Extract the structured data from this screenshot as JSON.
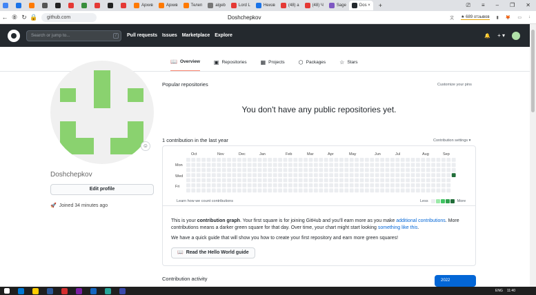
{
  "browser": {
    "tabs": [
      {
        "label": "",
        "color": "#4285f4"
      },
      {
        "label": "",
        "color": "#1a73e8"
      },
      {
        "label": "",
        "color": "#ff7a00"
      },
      {
        "label": "",
        "color": "#555555"
      },
      {
        "label": "",
        "color": "#222222"
      },
      {
        "label": "",
        "color": "#e53935"
      },
      {
        "label": "",
        "color": "#388e3c"
      },
      {
        "label": "",
        "color": "#e53935"
      },
      {
        "label": "",
        "color": "#222222"
      },
      {
        "label": "",
        "color": "#e53935"
      },
      {
        "label": "Архив",
        "color": "#ff7a00"
      },
      {
        "label": "Архив",
        "color": "#ff7a00"
      },
      {
        "label": "Телеп",
        "color": "#ff7a00"
      },
      {
        "label": "algeb",
        "color": "#777777"
      },
      {
        "label": "Lord L",
        "color": "#e53935"
      },
      {
        "label": "Неизв",
        "color": "#1a73e8"
      },
      {
        "label": "(48) a",
        "color": "#e53935"
      },
      {
        "label": "(48) Ч",
        "color": "#e53935"
      },
      {
        "label": "Sage",
        "color": "#7e57c2"
      },
      {
        "label": "Dos ×",
        "color": "#24292e",
        "active": true
      }
    ],
    "new_tab": "+",
    "url": "github.com",
    "page_title": "Doshchepkov",
    "rating_text": "★ 689 отзывов",
    "window_controls": [
      "⎚",
      "≡",
      "–",
      "❐",
      "✕"
    ]
  },
  "header": {
    "search_placeholder": "Search or jump to...",
    "search_shortcut": "/",
    "nav": [
      "Pull requests",
      "Issues",
      "Marketplace",
      "Explore"
    ],
    "bell": "🔔",
    "plus": "+ ▾"
  },
  "profile_tabs": [
    {
      "label": "Overview",
      "icon": "📖",
      "active": true
    },
    {
      "label": "Repositories",
      "icon": "▣"
    },
    {
      "label": "Projects",
      "icon": "▦"
    },
    {
      "label": "Packages",
      "icon": "⬡"
    },
    {
      "label": "Stars",
      "icon": "☆"
    }
  ],
  "profile": {
    "username": "Doshchepkov",
    "edit_button": "Edit profile",
    "joined": "Joined 34 minutes ago",
    "emoji_icon": "☺"
  },
  "popular": {
    "title": "Popular repositories",
    "customize": "Customize your pins",
    "empty": "You don't have any public repositories yet."
  },
  "contributions": {
    "title": "1 contribution in the last year",
    "settings": "Contribution settings ▾",
    "months": [
      "Oct",
      "Nov",
      "Dec",
      "Jan",
      "Feb",
      "Mar",
      "Apr",
      "May",
      "Jun",
      "Jul",
      "Aug",
      "Sep"
    ],
    "days": [
      "Mon",
      "Wed",
      "Fri"
    ],
    "learn": "Learn how we count contributions",
    "less": "Less",
    "more": "More",
    "weeks": 53,
    "active_cell": {
      "week": 52,
      "day": 3
    },
    "colors": {
      "empty": "#ebedf0",
      "l1": "#9be9a8",
      "l2": "#40c463",
      "l3": "#30a14e",
      "l4": "#216e39"
    }
  },
  "info": {
    "p1_a": "This is your ",
    "p1_b": "contribution graph",
    "p1_c": ". Your first square is for joining GitHub and you'll earn more as you make ",
    "p1_link1": "additional contributions",
    "p1_d": ". More contributions means a darker green square for that day. Over time, your chart might start looking ",
    "p1_link2": "something like this",
    "p1_e": ".",
    "p2": "We have a quick guide that will show you how to create your first repository and earn more green squares!",
    "button": "Read the Hello World guide"
  },
  "activity": {
    "title": "Contribution activity",
    "year": "2022"
  },
  "taskbar": {
    "lang": "ENG",
    "time": "11:40",
    "icon_colors": [
      "#0078d4",
      "#ffcc00",
      "#2b5797",
      "#d32f2f",
      "#7b1fa2",
      "#1565c0",
      "#26a69a",
      "#3949ab"
    ]
  }
}
